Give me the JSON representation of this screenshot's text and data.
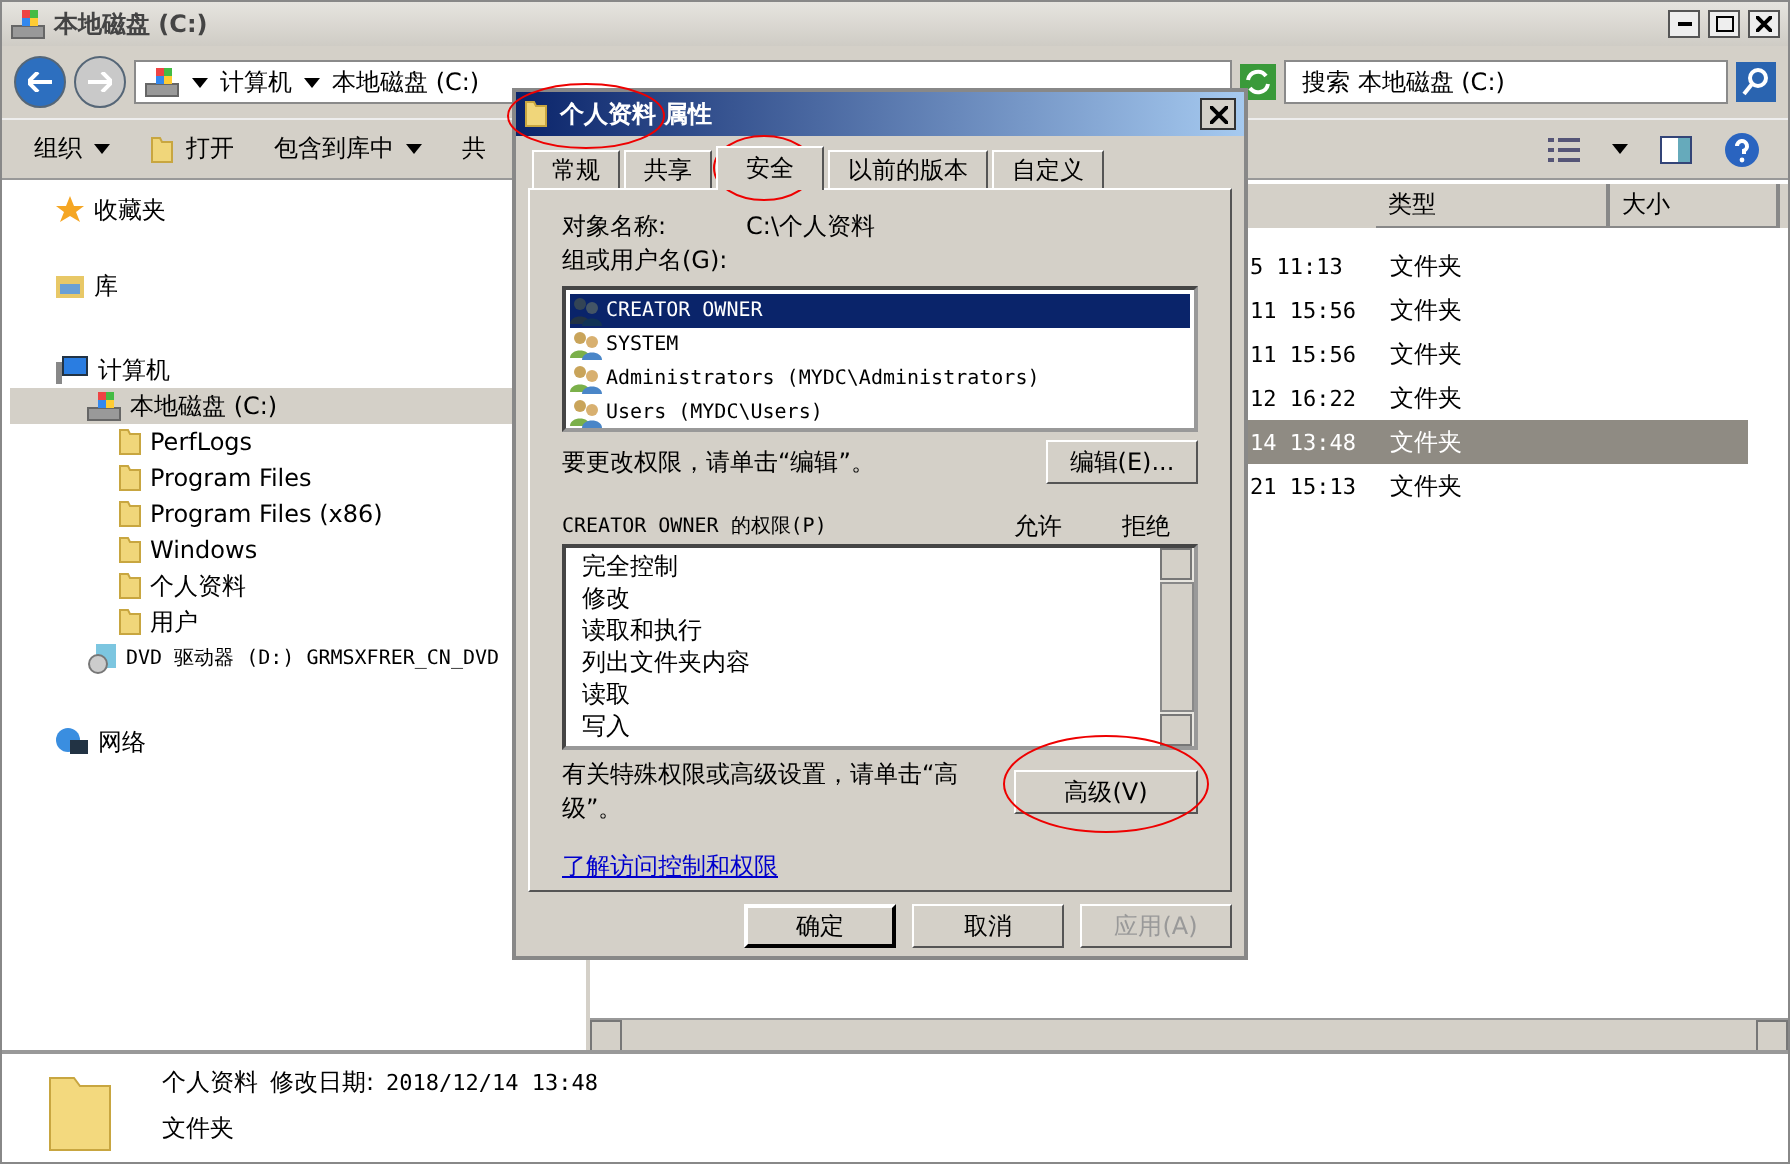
{
  "window": {
    "title": "本地磁盘 (C:)"
  },
  "address": {
    "crumbs": [
      "计算机",
      "本地磁盘 (C:)"
    ]
  },
  "search": {
    "placeholder": "搜索 本地磁盘 (C:)"
  },
  "toolbar": [
    {
      "label": "组织",
      "kind": "menu"
    },
    {
      "label": "打开",
      "kind": "icon"
    },
    {
      "label": "包含到库中",
      "kind": "menu"
    },
    {
      "label": "共",
      "kind": "plain"
    }
  ],
  "nav": [
    {
      "label": "收藏夹",
      "kind": "star",
      "selected": false
    },
    {
      "label": "库",
      "kind": "library",
      "selected": false
    },
    {
      "label": "计算机",
      "kind": "computer",
      "selected": false,
      "children": [
        {
          "label": "本地磁盘 (C:)",
          "kind": "drive",
          "selected": true,
          "children": [
            {
              "label": "PerfLogs",
              "kind": "folder",
              "selected": false
            },
            {
              "label": "Program Files",
              "kind": "folder",
              "selected": false
            },
            {
              "label": "Program Files (x86)",
              "kind": "folder",
              "selected": false
            },
            {
              "label": "Windows",
              "kind": "folder",
              "selected": false
            },
            {
              "label": "个人资料",
              "kind": "folder",
              "selected": false
            },
            {
              "label": "用户",
              "kind": "folder",
              "selected": false
            }
          ]
        },
        {
          "label": "DVD 驱动器 (D:) GRMSXFRER_CN_DVD",
          "kind": "dvd",
          "selected": false
        }
      ]
    },
    {
      "label": "网络",
      "kind": "network",
      "selected": false
    }
  ],
  "file_list": {
    "columns": [
      "类型",
      "大小"
    ],
    "rows": [
      {
        "column_1": "5 11:13",
        "type": "文件夹",
        "selected": false
      },
      {
        "column_1": "11 15:56",
        "type": "文件夹",
        "selected": false
      },
      {
        "column_1": "11 15:56",
        "type": "文件夹",
        "selected": false
      },
      {
        "column_1": "12 16:22",
        "type": "文件夹",
        "selected": false
      },
      {
        "column_1": "14 13:48",
        "type": "文件夹",
        "selected": true
      },
      {
        "column_1": "21 15:13",
        "type": "文件夹",
        "selected": false
      }
    ]
  },
  "details": {
    "name": "个人资料",
    "date_label": "修改日期:",
    "date": "2018/12/14 13:48",
    "type": "文件夹"
  },
  "dialog": {
    "title": "个人资料 属性",
    "tabs": [
      {
        "label": "常规",
        "selected": false
      },
      {
        "label": "共享",
        "selected": false
      },
      {
        "label": "安全",
        "selected": true
      },
      {
        "label": "以前的版本",
        "selected": false
      },
      {
        "label": "自定义",
        "selected": false
      }
    ],
    "object_label": "对象名称:",
    "object_value": "C:\\个人资料",
    "group_label": "组或用户名(G):",
    "users": [
      {
        "label": "CREATOR OWNER",
        "selected": true
      },
      {
        "label": "SYSTEM",
        "selected": false
      },
      {
        "label": "Administrators (MYDC\\Administrators)",
        "selected": false
      },
      {
        "label": "Users (MYDC\\Users)",
        "selected": false
      }
    ],
    "edit_hint": "要更改权限，请单击“编辑”。",
    "edit_button": "编辑(E)...",
    "perm_label": "CREATOR OWNER 的权限(P)",
    "allow_label": "允许",
    "deny_label": "拒绝",
    "permissions": [
      "完全控制",
      "修改",
      "读取和执行",
      "列出文件夹内容",
      "读取",
      "写入"
    ],
    "advanced_hint": "有关特殊权限或高级设置，请单击“高级”。",
    "advanced_button": "高级(V)",
    "link": "了解访问控制和权限",
    "buttons": [
      {
        "label": "确定",
        "disabled": false,
        "default": true
      },
      {
        "label": "取消",
        "disabled": false,
        "default": false
      },
      {
        "label": "应用(A)",
        "disabled": true,
        "default": false
      }
    ]
  }
}
